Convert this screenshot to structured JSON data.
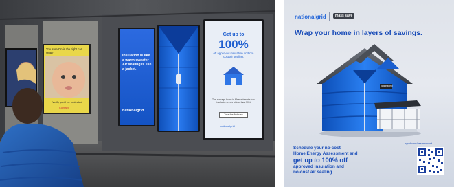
{
  "photo": {
    "left_poster": {
      "headline": "You sure I'm in the right car seat?",
      "footer": "Verify you'll be protected",
      "footer_brand": "Contact"
    },
    "display_left": {
      "body": "Insulation is like a warm sweater. Air sealing is like a jacket.",
      "brand": "nationalgrid"
    },
    "display_right": {
      "headline_top": "Get up to",
      "headline_big": "100%",
      "subhead": "off approved insulation and no-cost air sealing.",
      "body": "The average home in Massachusetts has insulation levels at less than 50%",
      "button": "Take the first step",
      "brand": "nationalgrid"
    }
  },
  "print_ad": {
    "brand": "nationalgrid",
    "partner": "mass save",
    "headline": "Wrap your home in layers of savings.",
    "cta_lines": [
      "Schedule your no-cost",
      "Home Energy Assessment and"
    ],
    "offer_lines": [
      "get up to 100% off"
    ],
    "tail_lines": [
      "approved insulation and",
      "no-cost air sealing."
    ],
    "url": "ngrid.com/assessment",
    "house_tag": "nationalgrid"
  },
  "colors": {
    "ng_blue": "#1f63d8",
    "print_text": "#1a4db8",
    "jacket_blue": "#1567d9"
  }
}
